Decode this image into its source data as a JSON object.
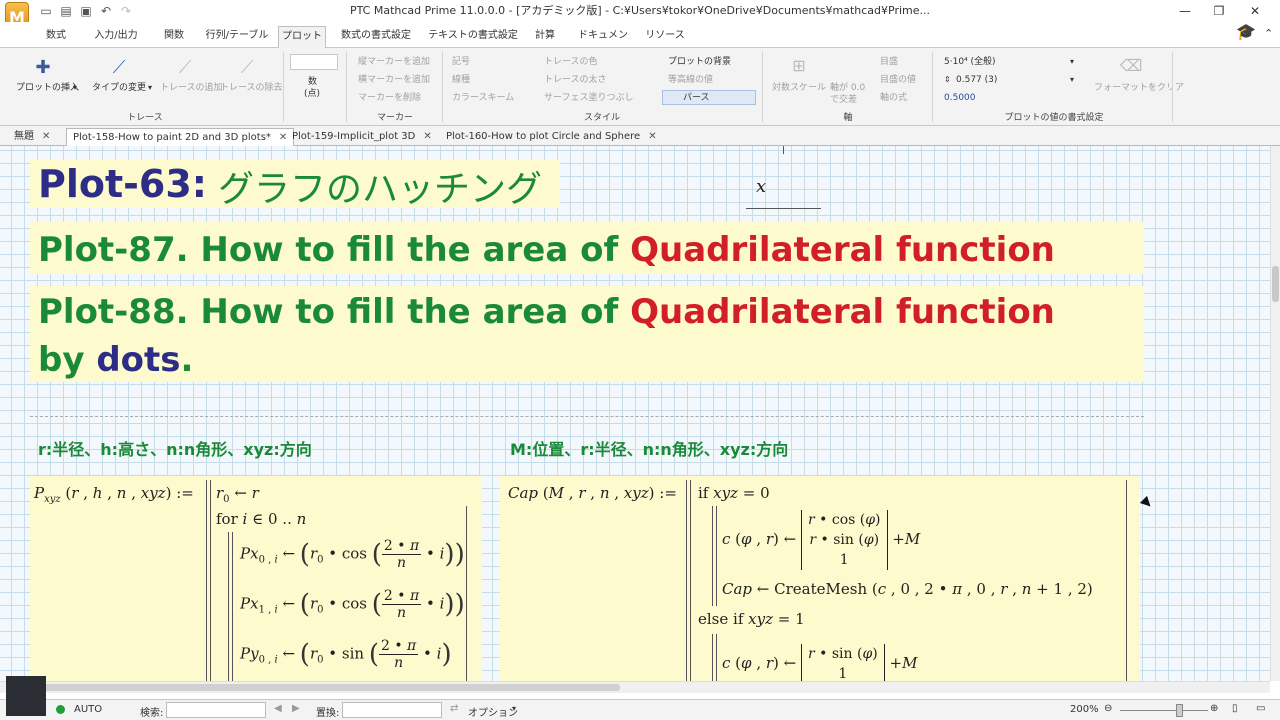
{
  "window": {
    "title": "PTC Mathcad Prime 11.0.0.0 - [アカデミック版] - C:¥Users¥tokor¥OneDrive¥Documents¥mathcad¥Prime..."
  },
  "app_logo": "M",
  "ribbon_tabs": [
    "数式",
    "入力/出力",
    "関数",
    "行列/テーブル",
    "プロット",
    "数式の書式設定",
    "テキストの書式設定",
    "計算",
    "ドキュメント",
    "リソース"
  ],
  "ribbon": {
    "insert_plot": "プロットの挿入",
    "change_type": "タイプの変更",
    "add_trace": "トレースの追加",
    "remove_trace": "トレースの除去",
    "group_trace": "トレース",
    "num_label": "数",
    "num_sub": "(点)",
    "add_vmarker": "縦マーカーを追加",
    "add_hmarker": "横マーカーを追加",
    "remove_marker": "マーカーを削除",
    "group_marker": "マーカー",
    "symbol": "記号",
    "line": "線種",
    "color_scheme": "カラースキーム",
    "trace_color": "トレースの色",
    "trace_weight": "トレースの太さ",
    "surface_fill": "サーフェス塗りつぶし",
    "plot_bg": "プロットの背景",
    "contour_val": "等高線の値",
    "perspective": "パース",
    "group_style": "スタイル",
    "log_scale": "対数スケール",
    "axis_cross_1": "軸が 0.0",
    "axis_cross_2": "で交差",
    "tick": "目盛",
    "tick_val": "目盛の値",
    "axis_eq": "軸の式",
    "group_axis": "軸",
    "fmt_general": "5·10⁴ (全般)",
    "fmt_digits": "0.577 (3)",
    "fmt_value": "0.5000",
    "clear_format": "フォーマットをクリア",
    "group_format": "プロットの値の書式設定"
  },
  "doc_tabs": [
    {
      "label": "無題"
    },
    {
      "label": "Plot-158-How to paint 2D and 3D plots*"
    },
    {
      "label": "Plot-159-Implicit_plot 3D"
    },
    {
      "label": "Plot-160-How to plot Circle and Sphere"
    }
  ],
  "worksheet": {
    "h1a": "Plot-63:",
    "h1b": "グラフのハッチング",
    "x_label": "x",
    "h2a": "Plot-87. How to fill the area of ",
    "h2b": "Quadrilateral function",
    ".": ".",
    "h3a": "Plot-88. How to fill the area of ",
    "h3b": "Quadrilateral function",
    "h3c": "by ",
    "h3d": "dots",
    "h3e": ".",
    "left_desc": "r:半径、h:高さ、n:n角形、xyz:方向",
    "right_desc": "M:位置、r:半径、n:n角形、xyz:方向"
  },
  "status": {
    "auto": "AUTO",
    "search": "検索:",
    "replace": "置換:",
    "options": "オプション",
    "zoom": "200%"
  }
}
